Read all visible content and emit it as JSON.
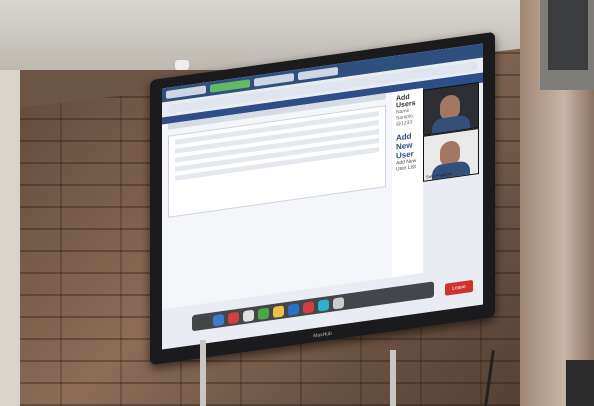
{
  "scene": {
    "screen_side_panel": {
      "title": "Add Users",
      "subtitle": "Name Sample, @1233",
      "heading": "Add New User",
      "subheading": "Add New User List"
    },
    "video_tile": {
      "participant_name": "Sahil Prajapati"
    },
    "leave_button": "Leave",
    "tv_brand": "MaxHub"
  },
  "colors": {
    "leave_button": "#d0312d",
    "app_header": "#2d4e86",
    "wall": "#6d5546"
  }
}
